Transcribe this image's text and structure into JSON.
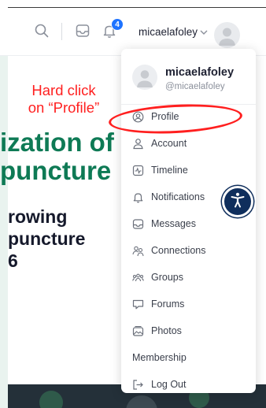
{
  "header": {
    "notification_count": "4",
    "username": "micaelafoley"
  },
  "annotation": {
    "line1": "Hard click",
    "line2": "on “Profile”"
  },
  "hero": {
    "line1": "ization of",
    "line2": "puncture",
    "sub1": "rowing",
    "sub2": "puncture",
    "sub3": "6"
  },
  "dropdown": {
    "name": "micaelafoley",
    "handle": "@micaelafoley",
    "items": [
      {
        "label": "Profile",
        "icon": "user-circle-icon"
      },
      {
        "label": "Account",
        "icon": "user-icon"
      },
      {
        "label": "Timeline",
        "icon": "activity-icon"
      },
      {
        "label": "Notifications",
        "icon": "bell-icon"
      },
      {
        "label": "Messages",
        "icon": "inbox-icon"
      },
      {
        "label": "Connections",
        "icon": "users-icon"
      },
      {
        "label": "Groups",
        "icon": "groups-icon"
      },
      {
        "label": "Forums",
        "icon": "chat-icon"
      },
      {
        "label": "Photos",
        "icon": "images-icon"
      },
      {
        "label": "Membership",
        "icon": ""
      },
      {
        "label": "Log Out",
        "icon": "logout-icon"
      }
    ]
  },
  "colors": {
    "accent": "#1e73ff",
    "heading_green": "#0e7a55",
    "annotation_red": "#ff1f1f",
    "accessibility_navy": "#0f2e5c"
  }
}
